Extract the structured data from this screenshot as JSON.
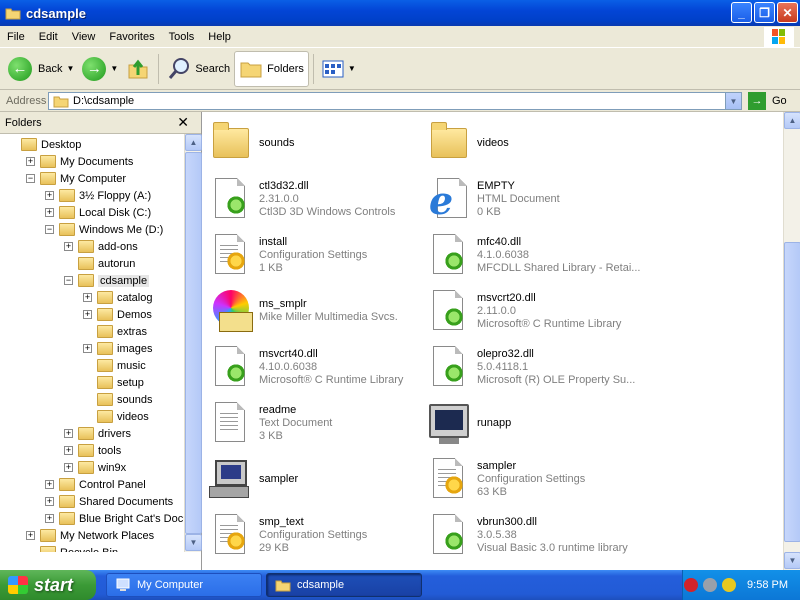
{
  "window": {
    "title": "cdsample"
  },
  "menu": [
    "File",
    "Edit",
    "View",
    "Favorites",
    "Tools",
    "Help"
  ],
  "toolbar": {
    "back": "Back",
    "search": "Search",
    "folders": "Folders"
  },
  "address": {
    "label": "Address",
    "value": "D:\\cdsample",
    "go": "Go"
  },
  "folders_pane": {
    "title": "Folders"
  },
  "tree": [
    {
      "label": "Desktop",
      "level": 0,
      "expander": ""
    },
    {
      "label": "My Documents",
      "level": 1,
      "expander": "+"
    },
    {
      "label": "My Computer",
      "level": 1,
      "expander": "-"
    },
    {
      "label": "3½ Floppy (A:)",
      "level": 2,
      "expander": "+"
    },
    {
      "label": "Local Disk (C:)",
      "level": 2,
      "expander": "+"
    },
    {
      "label": "Windows Me (D:)",
      "level": 2,
      "expander": "-"
    },
    {
      "label": "add-ons",
      "level": 3,
      "expander": "+"
    },
    {
      "label": "autorun",
      "level": 3,
      "expander": ""
    },
    {
      "label": "cdsample",
      "level": 3,
      "expander": "-",
      "selected": true
    },
    {
      "label": "catalog",
      "level": 4,
      "expander": "+"
    },
    {
      "label": "Demos",
      "level": 4,
      "expander": "+"
    },
    {
      "label": "extras",
      "level": 4,
      "expander": ""
    },
    {
      "label": "images",
      "level": 4,
      "expander": "+"
    },
    {
      "label": "music",
      "level": 4,
      "expander": ""
    },
    {
      "label": "setup",
      "level": 4,
      "expander": ""
    },
    {
      "label": "sounds",
      "level": 4,
      "expander": ""
    },
    {
      "label": "videos",
      "level": 4,
      "expander": ""
    },
    {
      "label": "drivers",
      "level": 3,
      "expander": "+"
    },
    {
      "label": "tools",
      "level": 3,
      "expander": "+"
    },
    {
      "label": "win9x",
      "level": 3,
      "expander": "+"
    },
    {
      "label": "Control Panel",
      "level": 2,
      "expander": "+"
    },
    {
      "label": "Shared Documents",
      "level": 2,
      "expander": "+"
    },
    {
      "label": "Blue Bright Cat's Documents",
      "level": 2,
      "expander": "+"
    },
    {
      "label": "My Network Places",
      "level": 1,
      "expander": "+"
    },
    {
      "label": "Recycle Bin",
      "level": 1,
      "expander": ""
    }
  ],
  "files": [
    {
      "name": "sounds",
      "line2": "",
      "line3": "",
      "icon": "folder-icon"
    },
    {
      "name": "videos",
      "line2": "",
      "line3": "",
      "icon": "folder-icon"
    },
    {
      "name": "ctl3d32.dll",
      "line2": "2.31.0.0",
      "line3": "Ctl3D 3D Windows Controls",
      "icon": "dll-icon"
    },
    {
      "name": "EMPTY",
      "line2": "HTML Document",
      "line3": "0 KB",
      "icon": "ie-html-icon"
    },
    {
      "name": "install",
      "line2": "Configuration Settings",
      "line3": "1 KB",
      "icon": "config-file-icon"
    },
    {
      "name": "mfc40.dll",
      "line2": "4.1.0.6038",
      "line3": "MFCDLL Shared Library - Retai...",
      "icon": "dll-icon"
    },
    {
      "name": "ms_smplr",
      "line2": "Mike Miller Multimedia Svcs.",
      "line3": "",
      "icon": "cd-book-icon"
    },
    {
      "name": "msvcrt20.dll",
      "line2": "2.11.0.0",
      "line3": "Microsoft® C Runtime Library",
      "icon": "dll-icon"
    },
    {
      "name": "msvcrt40.dll",
      "line2": "4.10.0.6038",
      "line3": "Microsoft® C Runtime Library",
      "icon": "dll-icon"
    },
    {
      "name": "olepro32.dll",
      "line2": "5.0.4118.1",
      "line3": "Microsoft (R) OLE Property Su...",
      "icon": "dll-icon"
    },
    {
      "name": "readme",
      "line2": "Text Document",
      "line3": "3 KB",
      "icon": "text-document-icon"
    },
    {
      "name": "runapp",
      "line2": "",
      "line3": "",
      "icon": "monitor-app-icon"
    },
    {
      "name": "sampler",
      "line2": "",
      "line3": "",
      "icon": "computer-app-icon"
    },
    {
      "name": "sampler",
      "line2": "Configuration Settings",
      "line3": "63 KB",
      "icon": "config-file-icon"
    },
    {
      "name": "smp_text",
      "line2": "Configuration Settings",
      "line3": "29 KB",
      "icon": "config-file-icon"
    },
    {
      "name": "vbrun300.dll",
      "line2": "3.0.5.38",
      "line3": "Visual Basic 3.0 runtime library",
      "icon": "dll-icon"
    }
  ],
  "taskbar": {
    "start": "start",
    "tasks": [
      "My Computer",
      "cdsample"
    ],
    "clock": "9:58 PM"
  }
}
